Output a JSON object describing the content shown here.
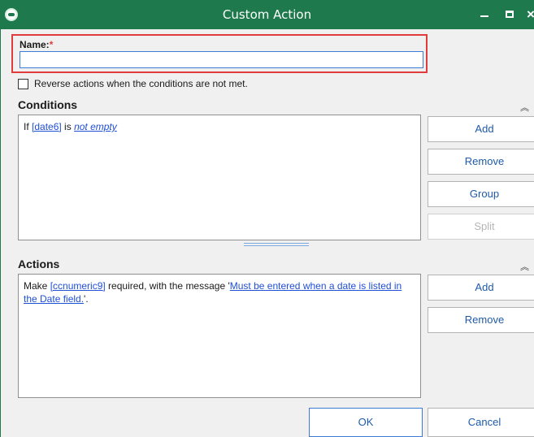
{
  "window": {
    "title": "Custom Action",
    "accent_color": "#1e7a4c",
    "controls": {
      "minimize_icon": "minimize-icon",
      "maximize_icon": "maximize-icon",
      "close_icon": "close-icon",
      "close_glyph": "×"
    }
  },
  "name_field": {
    "label": "Name:",
    "required_mark": "*",
    "value": "",
    "highlight_color": "#e03c3c"
  },
  "reverse_checkbox": {
    "label": "Reverse actions when the conditions are not met.",
    "checked": false
  },
  "conditions": {
    "title": "Conditions",
    "collapse_glyph": "︽",
    "items": [
      {
        "prefix": "If ",
        "field": "[date6]",
        "middle": " is ",
        "operator": "not empty"
      }
    ],
    "buttons": {
      "add": "Add",
      "remove": "Remove",
      "group": "Group",
      "split": "Split"
    }
  },
  "actions": {
    "title": "Actions",
    "collapse_glyph": "︽",
    "items": [
      {
        "prefix": "Make ",
        "field": "[ccnumeric9]",
        "middle": " required, with the message '",
        "message": "Must be entered when a date is listed in the Date field.",
        "suffix": "'."
      }
    ],
    "buttons": {
      "add": "Add",
      "remove": "Remove"
    }
  },
  "footer": {
    "ok": "OK",
    "cancel": "Cancel"
  }
}
